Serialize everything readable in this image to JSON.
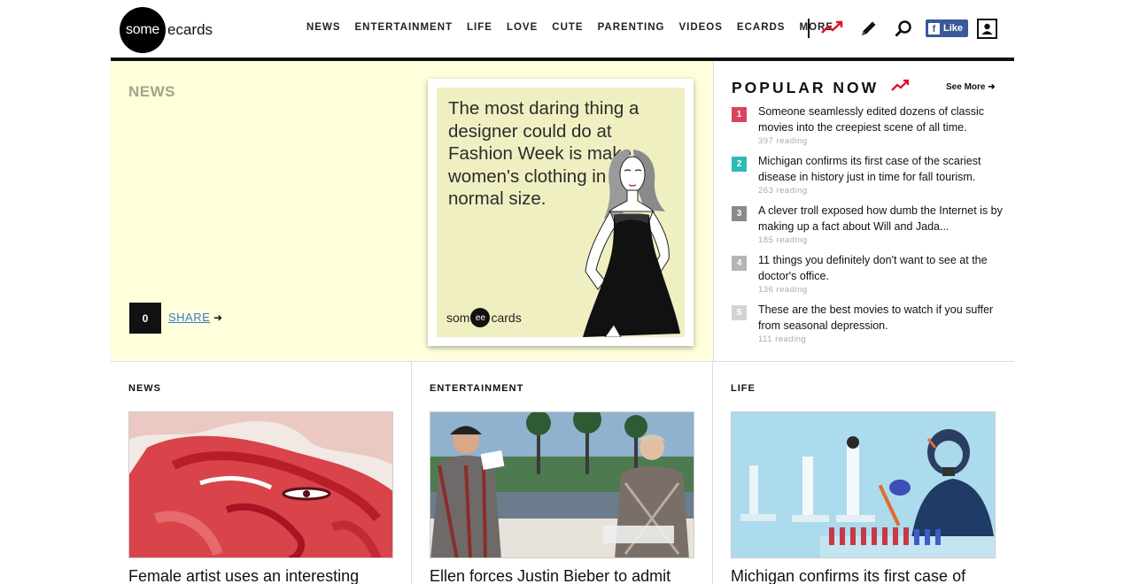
{
  "header": {
    "logo_circle": "some",
    "logo_text": "ecards",
    "nav": [
      "NEWS",
      "ENTERTAINMENT",
      "LIFE",
      "LOVE",
      "CUTE",
      "PARENTING",
      "VIDEOS",
      "ECARDS",
      "MORE"
    ],
    "fb_like": "Like",
    "fb_f": "f",
    "icons": [
      "trending-icon",
      "pencil-icon",
      "search-icon",
      "user-icon"
    ]
  },
  "hero": {
    "label": "NEWS",
    "share_count": "0",
    "share_label": "SHARE",
    "share_arrow": "➜",
    "ecard_text": "The most daring thing a designer could do at Fashion Week is make women's clothing in a normal size.",
    "ecard_logo_left": "som",
    "ecard_logo_mid": "ee",
    "ecard_logo_right": "cards"
  },
  "popular": {
    "title": "POPULAR NOW",
    "see_more": "See More ➜",
    "items": [
      {
        "num": "1",
        "color": "#d9455f",
        "text": "Someone seamlessly edited dozens of classic movies into the creepiest scene of all time.",
        "reading": "397 reading"
      },
      {
        "num": "2",
        "color": "#2bbcb5",
        "text": "Michigan confirms its first case of the scariest disease in history just in time for fall tourism.",
        "reading": "263 reading"
      },
      {
        "num": "3",
        "color": "#8a8a8a",
        "text": "A clever troll exposed how dumb the Internet is by making up a fact about Will and Jada...",
        "reading": "185 reading"
      },
      {
        "num": "4",
        "color": "#b5b5b5",
        "text": "11 things you definitely don't want to see at the doctor's office.",
        "reading": "136 reading"
      },
      {
        "num": "5",
        "color": "#d3d3d3",
        "text": "These are the best movies to watch if you suffer from seasonal depression.",
        "reading": "111 reading"
      }
    ]
  },
  "columns": [
    {
      "label": "NEWS",
      "title": "Female artist uses an interesting"
    },
    {
      "label": "ENTERTAINMENT",
      "title": "Ellen forces Justin Bieber to admit"
    },
    {
      "label": "LIFE",
      "title": "Michigan confirms its first case of"
    }
  ]
}
